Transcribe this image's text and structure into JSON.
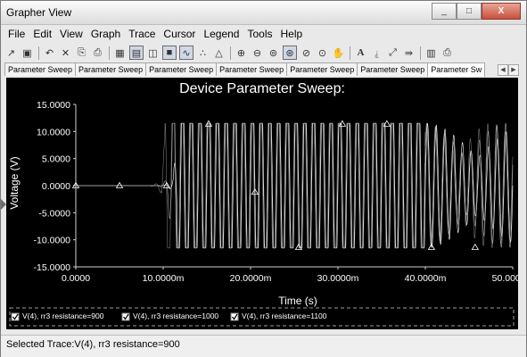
{
  "window": {
    "title": "Grapher View",
    "minimize_glyph": "_",
    "maximize_glyph": "□",
    "close_glyph": "X"
  },
  "menu": [
    "File",
    "Edit",
    "View",
    "Graph",
    "Trace",
    "Cursor",
    "Legend",
    "Tools",
    "Help"
  ],
  "toolbar": {
    "icons": [
      "open-icon",
      "save-icon",
      "undo-icon",
      "delete-icon",
      "copy-icon",
      "paste-icon",
      "grid-icon",
      "toggle-grid-icon",
      "multi-axis-icon",
      "black-background-icon",
      "show-lines-icon",
      "scatter-icon",
      "line-markers-icon",
      "zoom-in-icon",
      "zoom-out-icon",
      "zoom-area-icon",
      "zoom-fit-icon",
      "zoom-x-icon",
      "zoom-y-icon",
      "pan-icon",
      "text-icon",
      "text-off-icon",
      "trace-icon",
      "export-icon",
      "copy-graph-icon",
      "print-icon"
    ]
  },
  "tabs": [
    "Parameter Sweep",
    "Parameter Sweep",
    "Parameter Sweep",
    "Parameter Sweep",
    "Parameter Sweep",
    "Parameter Sweep",
    "Parameter Sw"
  ],
  "status": {
    "text": "Selected Trace:V(4), rr3 resistance=900"
  },
  "chart_data": {
    "type": "line",
    "title": "Device Parameter Sweep:",
    "xlabel": "Time (s)",
    "ylabel": "Voltage (V)",
    "xlim": [
      0,
      0.05
    ],
    "ylim": [
      -15,
      15
    ],
    "x_ticks": [
      "0.0000",
      "10.0000m",
      "20.0000m",
      "30.0000m",
      "40.0000m",
      "50.0000m"
    ],
    "y_ticks": [
      "15.0000",
      "10.0000",
      "5.0000",
      "0.0000",
      "-5.0000",
      "-10.0000",
      "-15.0000"
    ],
    "series": [
      {
        "name": "V(4), rr3 resistance=900",
        "color": "#ffffff",
        "amplitude": 11.5,
        "period": 0.001,
        "onset": 0.0112
      },
      {
        "name": "V(4), rr3 resistance=1000",
        "color": "#c8c8c8",
        "amplitude": 11.5,
        "period": 0.001,
        "onset": 0.0105
      },
      {
        "name": "V(4), rr3 resistance=1100",
        "color": "#a8a8a8",
        "amplitude": 11.5,
        "period": 0.001,
        "onset": 0.0098
      }
    ],
    "markers": [
      {
        "x": 0.0,
        "y": 0.0
      },
      {
        "x": 0.005,
        "y": 0.0
      },
      {
        "x": 0.0104,
        "y": 0.0
      },
      {
        "x": 0.0152,
        "y": 11.4
      },
      {
        "x": 0.0205,
        "y": -1.2
      },
      {
        "x": 0.0255,
        "y": -11.4
      },
      {
        "x": 0.0305,
        "y": 11.4
      },
      {
        "x": 0.0356,
        "y": 11.4
      },
      {
        "x": 0.0407,
        "y": -11.4
      },
      {
        "x": 0.0457,
        "y": -11.4
      }
    ],
    "grid": false,
    "background": "#000000",
    "legend_position": "bottom"
  }
}
